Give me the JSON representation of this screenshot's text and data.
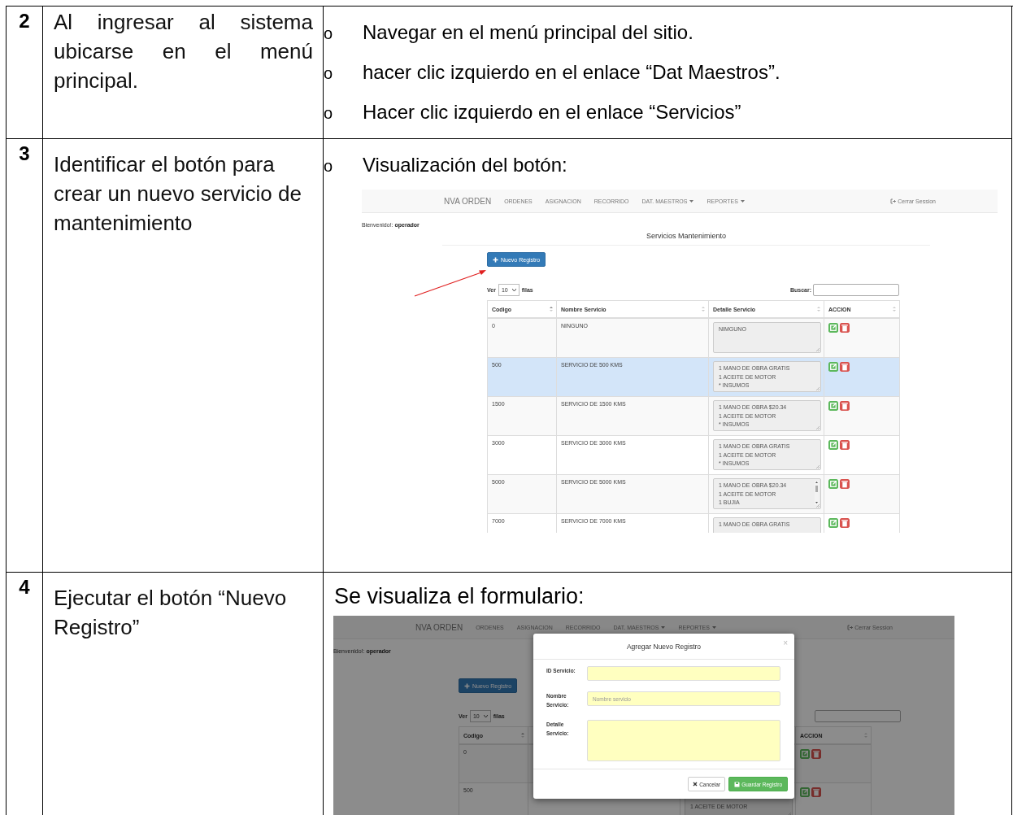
{
  "steps": [
    {
      "number": "2",
      "description": "Al ingresar al sistema ubicarse en el menú principal.",
      "justified": true,
      "content": {
        "kind": "bullets",
        "items": [
          {
            "marker": "o",
            "text": "Navegar en el menú principal del sitio."
          },
          {
            "marker": "o",
            "text": "hacer clic izquierdo en el enlace “Dat Maestros”."
          },
          {
            "marker": "o",
            "text": "Hacer clic izquierdo en el enlace “Servicios”"
          }
        ]
      }
    },
    {
      "number": "3",
      "description": "Identificar el botón para crear un nuevo servicio de mantenimiento",
      "justified": false,
      "content": {
        "kind": "bullets",
        "items": [
          {
            "marker": "o",
            "text": "Visualización del botón:"
          }
        ],
        "screenshot": {
          "navbar": {
            "brand": "NVA ORDEN",
            "items": [
              {
                "label": "ORDENES",
                "dropdown": false
              },
              {
                "label": "ASIGNACION",
                "dropdown": false
              },
              {
                "label": "RECORRIDO",
                "dropdown": false
              },
              {
                "label": "DAT. MAESTROS",
                "dropdown": true
              },
              {
                "label": "REPORTES",
                "dropdown": true
              }
            ],
            "logout": "Cerrar Session"
          },
          "welcome_label": "Bienvenido!:",
          "welcome_user": "operador",
          "title": "Servicios Mantenimiento",
          "new_button": "Nuevo Registro",
          "pointer_arrow": true,
          "length_prefix": "Ver",
          "length_value": "10",
          "length_suffix": "filas",
          "search_label": "Buscar:",
          "columns": [
            "Codigo",
            "Nombre Servicio",
            "Detalle Servicio",
            "ACCION"
          ],
          "rows": [
            {
              "code": "0",
              "name": "NINGUNO",
              "detail": [
                "NIMGUNO"
              ],
              "selected": false
            },
            {
              "code": "500",
              "name": "SERVICIO DE 500 KMS",
              "detail": [
                "1 MANO DE OBRA GRATIS",
                "1 ACEITE DE MOTOR",
                "* INSUMOS"
              ],
              "selected": true
            },
            {
              "code": "1500",
              "name": "SERVICIO DE 1500 KMS",
              "detail": [
                "1 MANO DE OBRA $20.34",
                "1 ACEITE DE MOTOR",
                "* INSUMOS"
              ],
              "selected": false
            },
            {
              "code": "3000",
              "name": "SERVICIO DE 3000 KMS",
              "detail": [
                "1 MANO DE OBRA GRATIS",
                "1 ACEITE DE MOTOR",
                "* INSUMOS"
              ],
              "selected": false
            },
            {
              "code": "5000",
              "name": "SERVICIO DE 5000 KMS",
              "detail": [
                "1 MANO DE OBRA $20.34",
                "1 ACEITE DE MOTOR",
                "1 BUJIA"
              ],
              "selected": false,
              "scrollbar": true
            },
            {
              "code": "7000",
              "name": "SERVICIO DE 7000 KMS",
              "detail": [
                "1 MANO DE OBRA GRATIS"
              ],
              "selected": false
            }
          ]
        }
      }
    },
    {
      "number": "4",
      "description": "Ejecutar el botón “Nuevo Registro”",
      "justified": false,
      "content": {
        "kind": "caption",
        "caption": "Se visualiza el formulario:",
        "screenshot": {
          "navbar": {
            "brand": "NVA ORDEN",
            "items": [
              {
                "label": "ORDENES",
                "dropdown": false
              },
              {
                "label": "ASIGNACION",
                "dropdown": false
              },
              {
                "label": "RECORRIDO",
                "dropdown": false
              },
              {
                "label": "DAT. MAESTROS",
                "dropdown": true
              },
              {
                "label": "REPORTES",
                "dropdown": true
              }
            ],
            "logout": "Cerrar Session"
          },
          "welcome_label": "Bienvenido!:",
          "welcome_user": "operador",
          "new_button": "Nuevo Registro",
          "length_prefix": "Ver",
          "length_value": "10",
          "length_suffix": "filas",
          "columns": [
            "Codigo",
            "ACCION"
          ],
          "rows": [
            {
              "code": "0",
              "detail": [],
              "selected": false
            },
            {
              "code": "500",
              "detail": [
                "1 ACEITE DE MOTOR"
              ],
              "selected": false
            }
          ],
          "modal": {
            "title": "Agregar Nuevo Registro",
            "close": "×",
            "fields": [
              {
                "label": "ID Servicio:",
                "kind": "input"
              },
              {
                "label": "Nombre Servicio:",
                "kind": "input",
                "placeholder": "Nombre servicio"
              },
              {
                "label": "Detalle Servicio:",
                "kind": "textarea"
              }
            ],
            "cancel": "Cancelar",
            "save": "Guardar Registro"
          }
        }
      }
    }
  ]
}
